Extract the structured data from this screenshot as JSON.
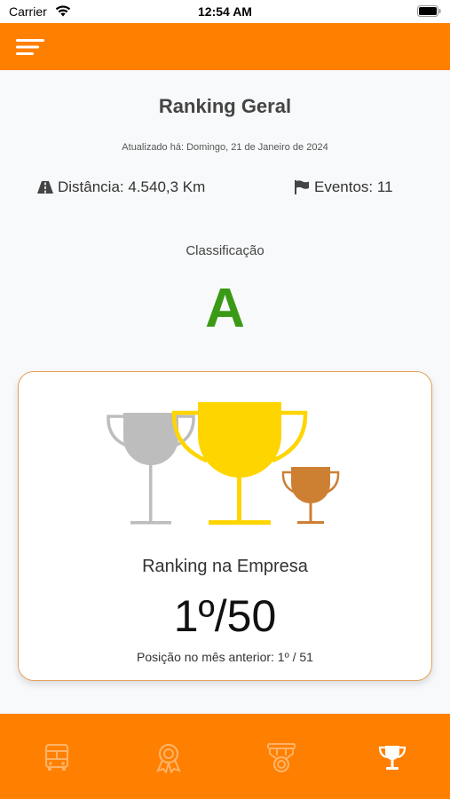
{
  "status_bar": {
    "carrier": "Carrier",
    "time": "12:54 AM"
  },
  "header": {
    "title": "Ranking Geral",
    "updated": "Atualizado há: Domingo, 21 de Janeiro de 2024"
  },
  "stats": {
    "distance": "Distância: 4.540,3 Km",
    "events": "Eventos: 11"
  },
  "classification": {
    "label": "Classificação",
    "grade": "A",
    "grade_color": "#3A9A16"
  },
  "ranking": {
    "label": "Ranking na Empresa",
    "position": "1º/50",
    "previous": "Posição no mês anterior: 1º / 51"
  },
  "theme": {
    "accent": "#FF7F00",
    "gold": "#FFD500",
    "silver": "#BDBDBD",
    "bronze": "#CD7F32"
  },
  "tabs": [
    {
      "icon": "bus-icon",
      "active": false
    },
    {
      "icon": "award-ribbon-icon",
      "active": false
    },
    {
      "icon": "medal-icon",
      "active": false
    },
    {
      "icon": "trophy-icon",
      "active": true
    }
  ]
}
